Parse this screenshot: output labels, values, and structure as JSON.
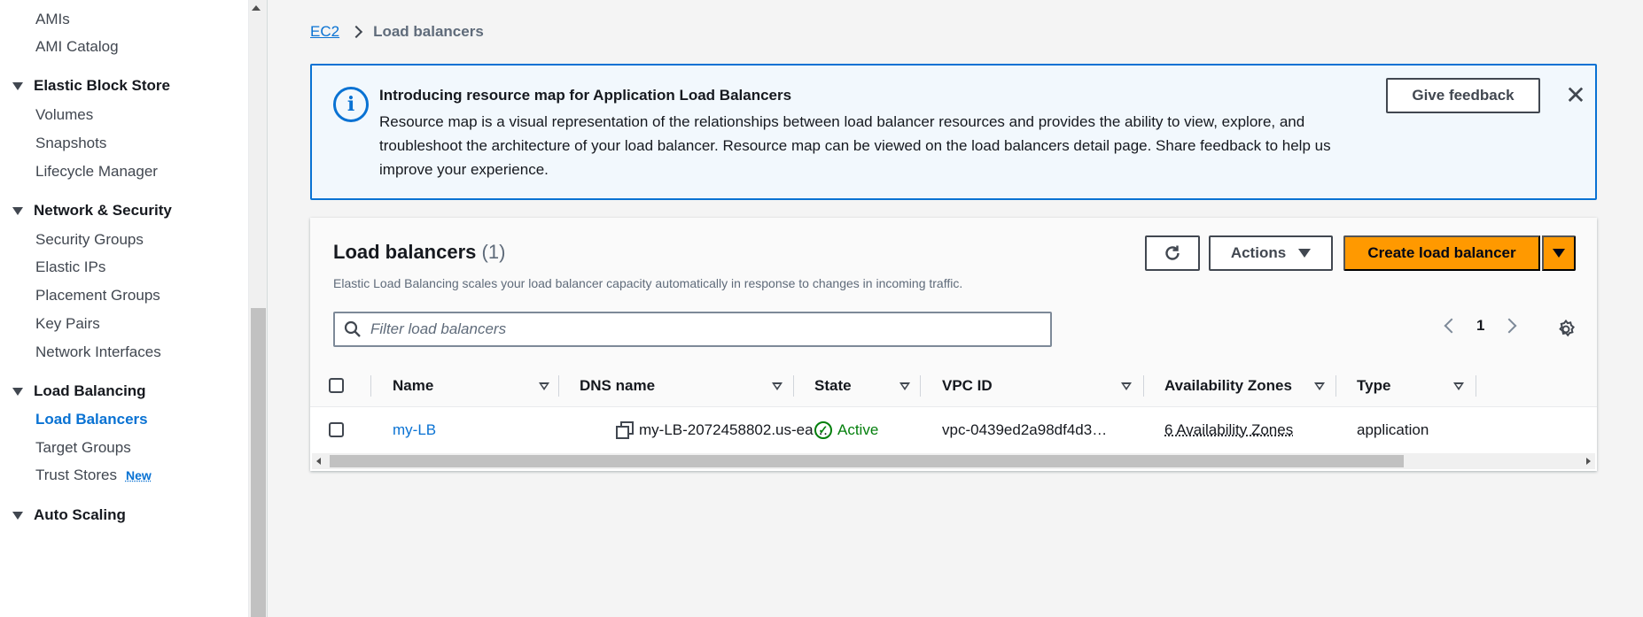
{
  "sidebar": {
    "items": [
      {
        "label": "AMIs"
      },
      {
        "label": "AMI Catalog"
      },
      {
        "section": "Elastic Block Store"
      },
      {
        "label": "Volumes"
      },
      {
        "label": "Snapshots"
      },
      {
        "label": "Lifecycle Manager"
      },
      {
        "section": "Network & Security"
      },
      {
        "label": "Security Groups"
      },
      {
        "label": "Elastic IPs"
      },
      {
        "label": "Placement Groups"
      },
      {
        "label": "Key Pairs"
      },
      {
        "label": "Network Interfaces"
      },
      {
        "section": "Load Balancing"
      },
      {
        "label": "Load Balancers",
        "active": true
      },
      {
        "label": "Target Groups"
      },
      {
        "label": "Trust Stores",
        "badge": "New"
      },
      {
        "section": "Auto Scaling"
      }
    ]
  },
  "breadcrumb": {
    "root": "EC2",
    "current": "Load balancers"
  },
  "banner": {
    "title": "Introducing resource map for Application Load Balancers",
    "body": "Resource map is a visual representation of the relationships between load balancer resources and provides the ability to view, explore, and troubleshoot the architecture of your load balancer. Resource map can be viewed on the load balancers detail page. Share feedback to help us improve your experience.",
    "feedback_label": "Give feedback",
    "close_glyph": "✕",
    "info_glyph": "i"
  },
  "panel": {
    "title": "Load balancers",
    "count": "(1)",
    "description": "Elastic Load Balancing scales your load balancer capacity automatically in response to changes in incoming traffic.",
    "actions_label": "Actions",
    "create_label": "Create load balancer",
    "filter_placeholder": "Filter load balancers",
    "page": "1"
  },
  "table": {
    "columns": [
      "Name",
      "DNS name",
      "State",
      "VPC ID",
      "Availability Zones",
      "Type"
    ],
    "rows": [
      {
        "name": "my-LB",
        "dns": "my-LB-2072458802.us-ea…",
        "state": "Active",
        "state_glyph": "✓",
        "vpc": "vpc-0439ed2a98df4d3…",
        "azs": "6 Availability Zones",
        "type": "application"
      }
    ]
  },
  "colors": {
    "accent": "#0972d3",
    "primary_button": "#ff9900",
    "success": "#037f0c",
    "banner_bg": "#f2f8fd"
  }
}
